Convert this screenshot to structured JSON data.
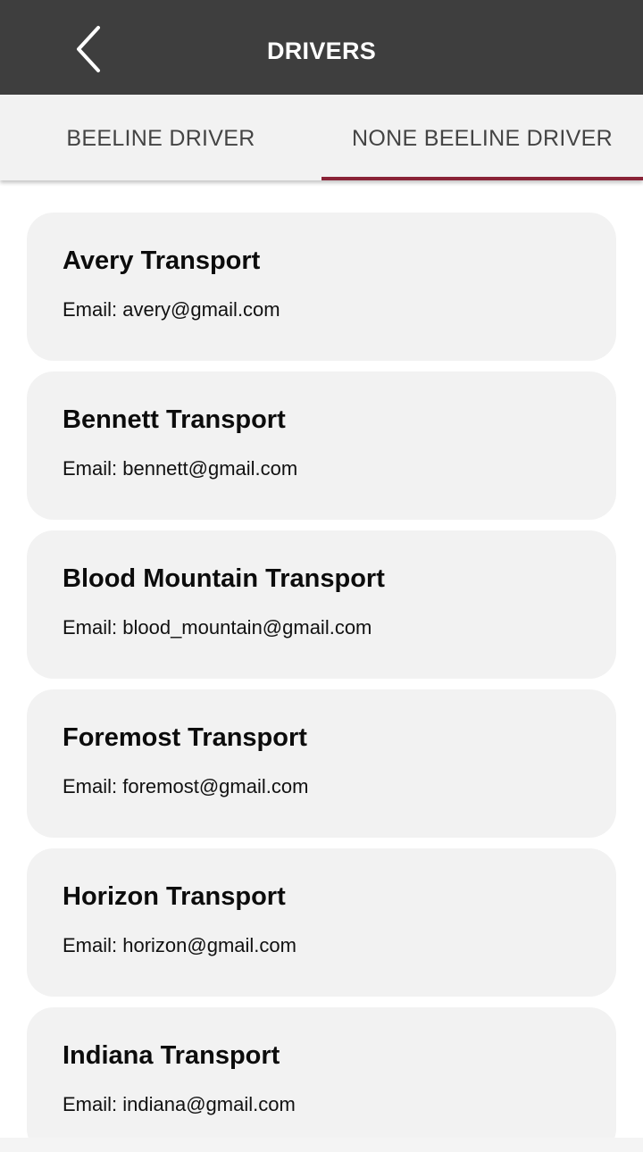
{
  "header": {
    "title": "DRIVERS",
    "back_icon": "chevron-left-icon"
  },
  "tabs": [
    {
      "label": "BEELINE DRIVER",
      "active": false
    },
    {
      "label": "NONE BEELINE DRIVER",
      "active": true
    }
  ],
  "colors": {
    "header_bg": "#3e3e3e",
    "tab_indicator": "#8a2337",
    "card_bg": "#f2f2f2"
  },
  "drivers": [
    {
      "name": "Avery Transport",
      "email": "Email: avery@gmail.com"
    },
    {
      "name": "Bennett Transport",
      "email": "Email: bennett@gmail.com"
    },
    {
      "name": "Blood Mountain Transport",
      "email": "Email: blood_mountain@gmail.com"
    },
    {
      "name": "Foremost Transport",
      "email": "Email: foremost@gmail.com"
    },
    {
      "name": "Horizon Transport",
      "email": "Email: horizon@gmail.com"
    },
    {
      "name": "Indiana Transport",
      "email": "Email: indiana@gmail.com"
    }
  ]
}
